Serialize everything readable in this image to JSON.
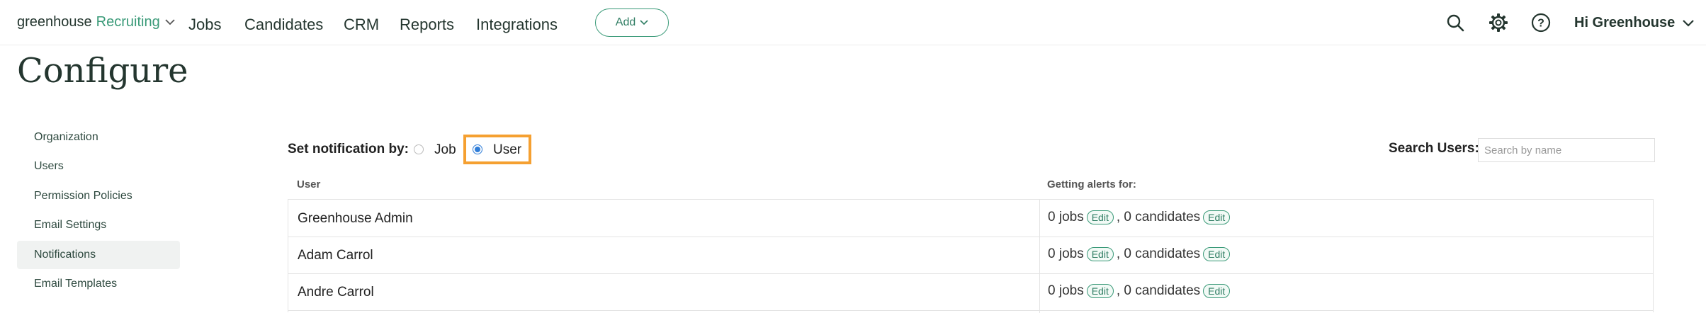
{
  "topbar": {
    "brand_greenhouse": "greenhouse",
    "brand_recruiting": "Recruiting",
    "nav": [
      "Jobs",
      "Candidates",
      "CRM",
      "Reports",
      "Integrations"
    ],
    "add_label": "Add",
    "greeting": "Hi Greenhouse",
    "icons": [
      "search-icon",
      "gear-icon",
      "help-icon"
    ]
  },
  "page": {
    "title": "Configure"
  },
  "sidebar": {
    "items": [
      {
        "label": "Organization",
        "active": false
      },
      {
        "label": "Users",
        "active": false
      },
      {
        "label": "Permission Policies",
        "active": false
      },
      {
        "label": "Email Settings",
        "active": false
      },
      {
        "label": "Notifications",
        "active": true
      },
      {
        "label": "Email Templates",
        "active": false
      }
    ]
  },
  "notifications": {
    "set_by_label": "Set notification by:",
    "option_job": "Job",
    "option_user": "User",
    "selected": "User",
    "search_label": "Search Users:",
    "search_placeholder": "Search by name",
    "search_value": ""
  },
  "table": {
    "columns": [
      "User",
      "Getting alerts for:"
    ],
    "rows": [
      {
        "user": "Greenhouse Admin",
        "jobs": "0 jobs",
        "candidates": ", 0 candidates",
        "edit": "Edit"
      },
      {
        "user": "Adam Carrol",
        "jobs": "0 jobs",
        "candidates": ", 0 candidates",
        "edit": "Edit"
      },
      {
        "user": "Andre Carrol",
        "jobs": "0 jobs",
        "candidates": ", 0 candidates",
        "edit": "Edit"
      }
    ]
  },
  "colors": {
    "brand_green": "#3a9a78",
    "highlight_orange": "#f5a031",
    "radio_blue": "#2f7dd8"
  }
}
